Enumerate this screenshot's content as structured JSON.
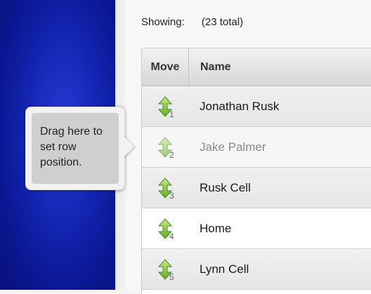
{
  "header": {
    "showing_label": "Showing:",
    "total_label": "(23 total)"
  },
  "table": {
    "columns": {
      "move": "Move",
      "name": "Name"
    },
    "rows": [
      {
        "position": "1",
        "name": "Jonathan Rusk"
      },
      {
        "position": "2",
        "name": "Jake Palmer"
      },
      {
        "position": "3",
        "name": "Rusk Cell"
      },
      {
        "position": "4",
        "name": "Home"
      },
      {
        "position": "5",
        "name": "Lynn Cell"
      }
    ]
  },
  "tooltip": {
    "text": "Drag here to set row position."
  },
  "colors": {
    "accent_blue": "#1326b4",
    "handle_green": "#7cc242"
  },
  "icons": {
    "move_handle": "vertical-move-arrows-icon"
  }
}
